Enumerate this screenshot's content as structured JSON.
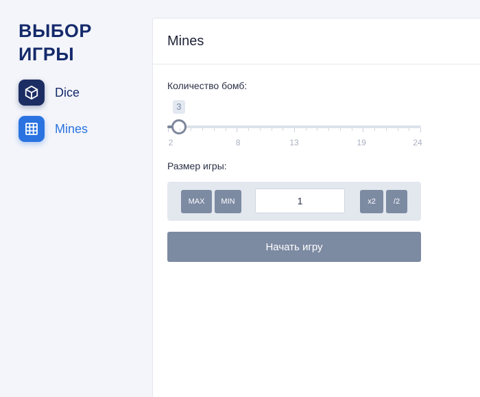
{
  "sidebar": {
    "title": "ВЫБОР\nИГРЫ",
    "items": [
      {
        "label": "Dice",
        "icon": "cube-icon",
        "active": false
      },
      {
        "label": "Mines",
        "icon": "grid-icon",
        "active": true
      }
    ]
  },
  "panel": {
    "title": "Mines",
    "bombs_label": "Количество бомб:",
    "slider": {
      "value": "3",
      "min": 2,
      "max": 24,
      "tick_labels": [
        "2",
        "8",
        "13",
        "19",
        "24"
      ]
    },
    "size_label": "Размер игры:",
    "buttons": {
      "max": "MAX",
      "min": "MIN",
      "double": "x2",
      "half": "/2"
    },
    "bet_value": "1",
    "start_label": "Начать игру"
  },
  "colors": {
    "title": "#152a6b",
    "active": "#2a73e0",
    "button": "#7c8aa2",
    "background": "#f3f5fa"
  }
}
